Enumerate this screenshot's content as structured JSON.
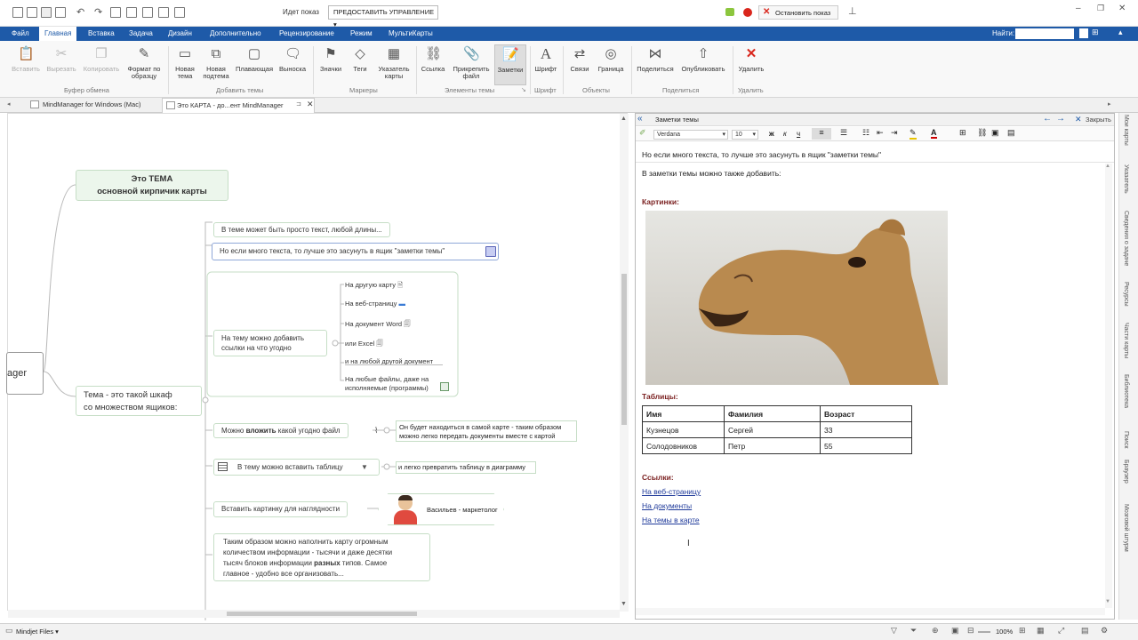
{
  "titlebar": {
    "showing": "Идет показ",
    "grant_control": "ПРЕДОСТАВИТЬ УПРАВЛЕНИЕ ▾",
    "stop_show": "Остановить показ"
  },
  "ribbon_tabs": [
    "Файл",
    "Главная",
    "Вставка",
    "Задача",
    "Дизайн",
    "Дополнительно",
    "Рецензирование",
    "Режим",
    "МультиКарты"
  ],
  "search_label": "Найти:",
  "ribbon": {
    "buttons": {
      "paste": "Вставить",
      "cut": "Вырезать",
      "copy": "Копировать",
      "format_painter": "Формат по образцу",
      "new_topic": "Новая тема",
      "new_subtopic": "Новая подтема",
      "floating": "Плавающая",
      "callout": "Выноска",
      "icons": "Значки",
      "tags": "Теги",
      "pointer": "Указатель карты",
      "link": "Ссылка",
      "attach": "Прикрепить файл",
      "notes": "Заметки",
      "font": "Шрифт",
      "relations": "Связи",
      "boundary": "Граница",
      "share": "Поделиться",
      "publish": "Опубликовать",
      "delete": "Удалить"
    },
    "groups": {
      "clipboard": "Буфер обмена",
      "add_topics": "Добавить темы",
      "markers": "Маркеры",
      "topic_elements": "Элементы темы",
      "font": "Шрифт",
      "objects": "Объекты",
      "share": "Поделиться",
      "delete": "Удалить"
    }
  },
  "doc_tabs": [
    "MindManager for Windows (Mac)",
    "Это КАРТА - до...ент MindManager"
  ],
  "map": {
    "central_partial": "ager",
    "topic_main_line1": "Это ТЕМА",
    "topic_main_line2": "основной кирпичик карты",
    "topic_shkaf_line1": "Тема  - это такой шкаф",
    "topic_shkaf_line2": "со множеством ящиков:",
    "sub_text": "В теме может быть просто текст, любой длины...",
    "sub_notes": "Но если много текста, то лучше это засунуть в ящик \"заметки темы\"",
    "sub_links_line1": "На тему можно добавить",
    "sub_links_line2": "ссылки на что угодно",
    "links": [
      "На другую карту",
      "На веб-страницу",
      "На документ Word",
      "или Excel",
      "и на любой другой документ"
    ],
    "link_files_line1": "На любые файлы, даже на",
    "link_files_line2": "исполняемые (программы)",
    "attach_pre": "Можно ",
    "attach_bold": "вложить",
    "attach_post": " какой угодно файл",
    "attach_callout_line1": "Он будет находиться в самой карте - таким образом",
    "attach_callout_line2": "можно легко передать документы вместе с картой",
    "table_topic": "В тему можно вставить таблицу",
    "table_callout": "и легко превратить таблицу в диаграмму",
    "picture_topic": "Вставить картинку для наглядности",
    "person_label": "Васильев - маркетолог",
    "summary_line1": "Таким образом можно наполнить карту огромным",
    "summary_line2": "количеством информации - тысячи и даже десятки",
    "summary_line3_pre": "тысяч блоков информации ",
    "summary_line3_bold": "разных",
    "summary_line3_post": " типов. Самое",
    "summary_line4": "главное - удобно все организовать..."
  },
  "notes": {
    "title": "Заметки темы",
    "close": "Закрыть",
    "font_name": "Verdana",
    "font_size": "10",
    "topic_line": "Но если много текста, то лучше это засунуть в ящик \"заметки темы\"",
    "intro": "В заметки темы можно также добавить:",
    "pictures_heading": "Картинки:",
    "tables_heading": "Таблицы:",
    "table": [
      [
        "Имя",
        "Фамилия",
        "Возраст"
      ],
      [
        "Кузнецов",
        "Сергей",
        "33"
      ],
      [
        "Солодовников",
        "Петр",
        "55"
      ]
    ],
    "links_heading": "Ссылки:",
    "links": [
      "На веб-страницу",
      "На документы",
      "На темы в карте"
    ]
  },
  "right_strip": [
    "Мои карты",
    "Указатель",
    "Сведения о задаче",
    "Ресурсы",
    "Части карты",
    "Библиотека",
    "Поиск",
    "Браузер",
    "Мозговой штурм"
  ],
  "status": {
    "files": "Mindjet Files ▾",
    "zoom": "100%"
  },
  "colors": {
    "ribbon_blue": "#1e5aa8",
    "node_border": "#c6dec6",
    "heading_red": "#7a1f1f",
    "link_blue": "#1f3a9a"
  }
}
